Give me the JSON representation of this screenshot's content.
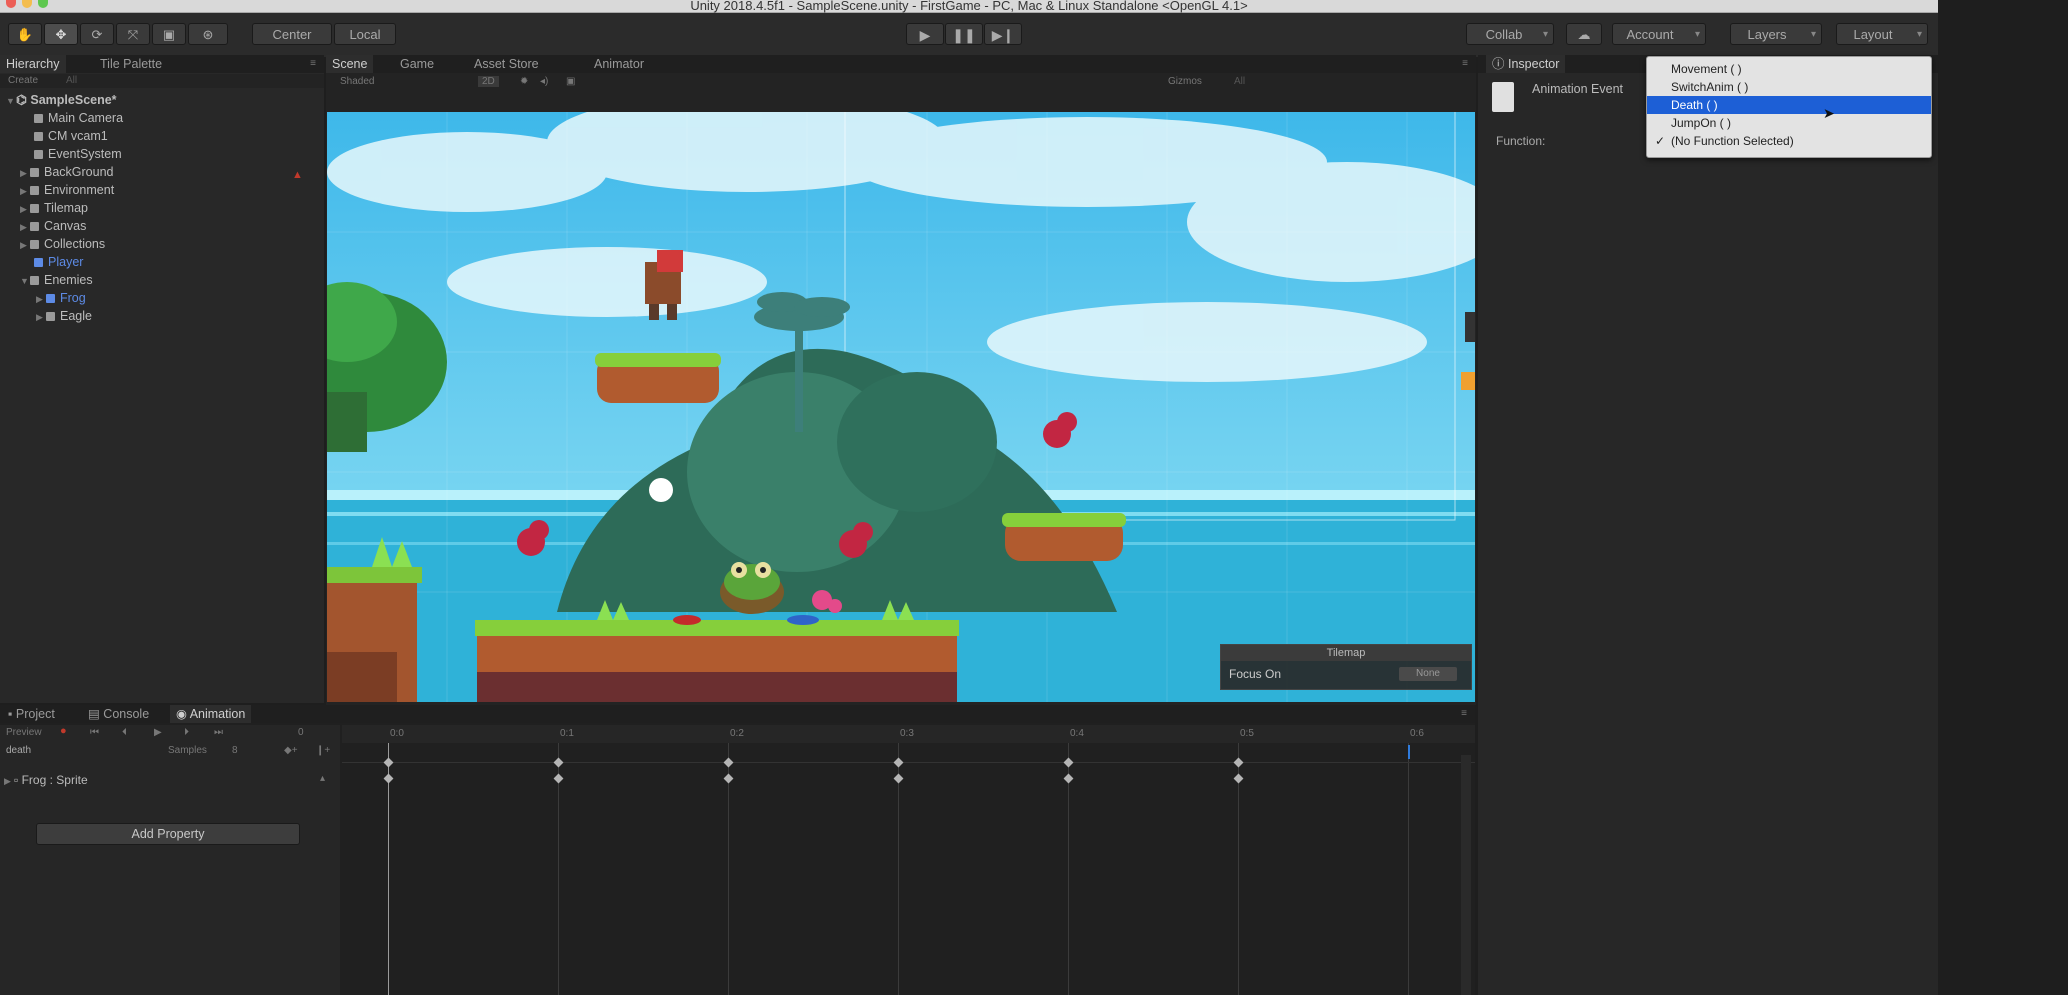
{
  "window": {
    "title": "Unity 2018.4.5f1 - SampleScene.unity - FirstGame - PC, Mac & Linux Standalone <OpenGL 4.1>"
  },
  "toolbar": {
    "pivot_label": "Center",
    "space_label": "Local",
    "collab_label": "Collab",
    "account_label": "Account",
    "layers_label": "Layers",
    "layout_label": "Layout"
  },
  "hierarchy": {
    "tabs": [
      "Hierarchy",
      "Tile Palette"
    ],
    "create_label": "Create",
    "search_placeholder": "All",
    "scene_name": "SampleScene*",
    "items": [
      "Main Camera",
      "CM vcam1",
      "EventSystem",
      "BackGround",
      "Environment",
      "Tilemap",
      "Canvas",
      "Collections",
      "Player",
      "Enemies",
      "Frog",
      "Eagle"
    ]
  },
  "scene_tabs": [
    "Scene",
    "Game",
    "Asset Store",
    "Animator"
  ],
  "scene_toolbar": {
    "shading": "Shaded",
    "mode_2d": "2D",
    "gizmos": "Gizmos",
    "search_placeholder": "All"
  },
  "tilemap_overlay": {
    "title": "Tilemap",
    "focus_label": "Focus On",
    "focus_value": "None"
  },
  "inspector": {
    "tab": "Inspector",
    "component": "Animation Event",
    "function_label": "Function:"
  },
  "function_menu": {
    "items": [
      "Movement ( )",
      "SwitchAnim ( )",
      "Death ( )",
      "JumpOn ( )",
      "(No Function Selected)"
    ],
    "highlighted": "Death ( )",
    "checked": "(No Function Selected)"
  },
  "bottom_tabs": [
    "Project",
    "Console",
    "Animation"
  ],
  "animation": {
    "preview_label": "Preview",
    "clip_name": "death",
    "samples_label": "Samples",
    "samples_value": "8",
    "property": "Frog : Sprite",
    "add_property": "Add Property",
    "frame_field": "0",
    "time_labels": [
      "0:0",
      "0:1",
      "0:2",
      "0:3",
      "0:4",
      "0:5",
      "0:6"
    ],
    "keyframe_count": 6
  },
  "colors": {
    "accent": "#1d5fd6",
    "sky": "#53c6ee",
    "record": "#c0392b",
    "selected_text": "#5d8be6"
  }
}
